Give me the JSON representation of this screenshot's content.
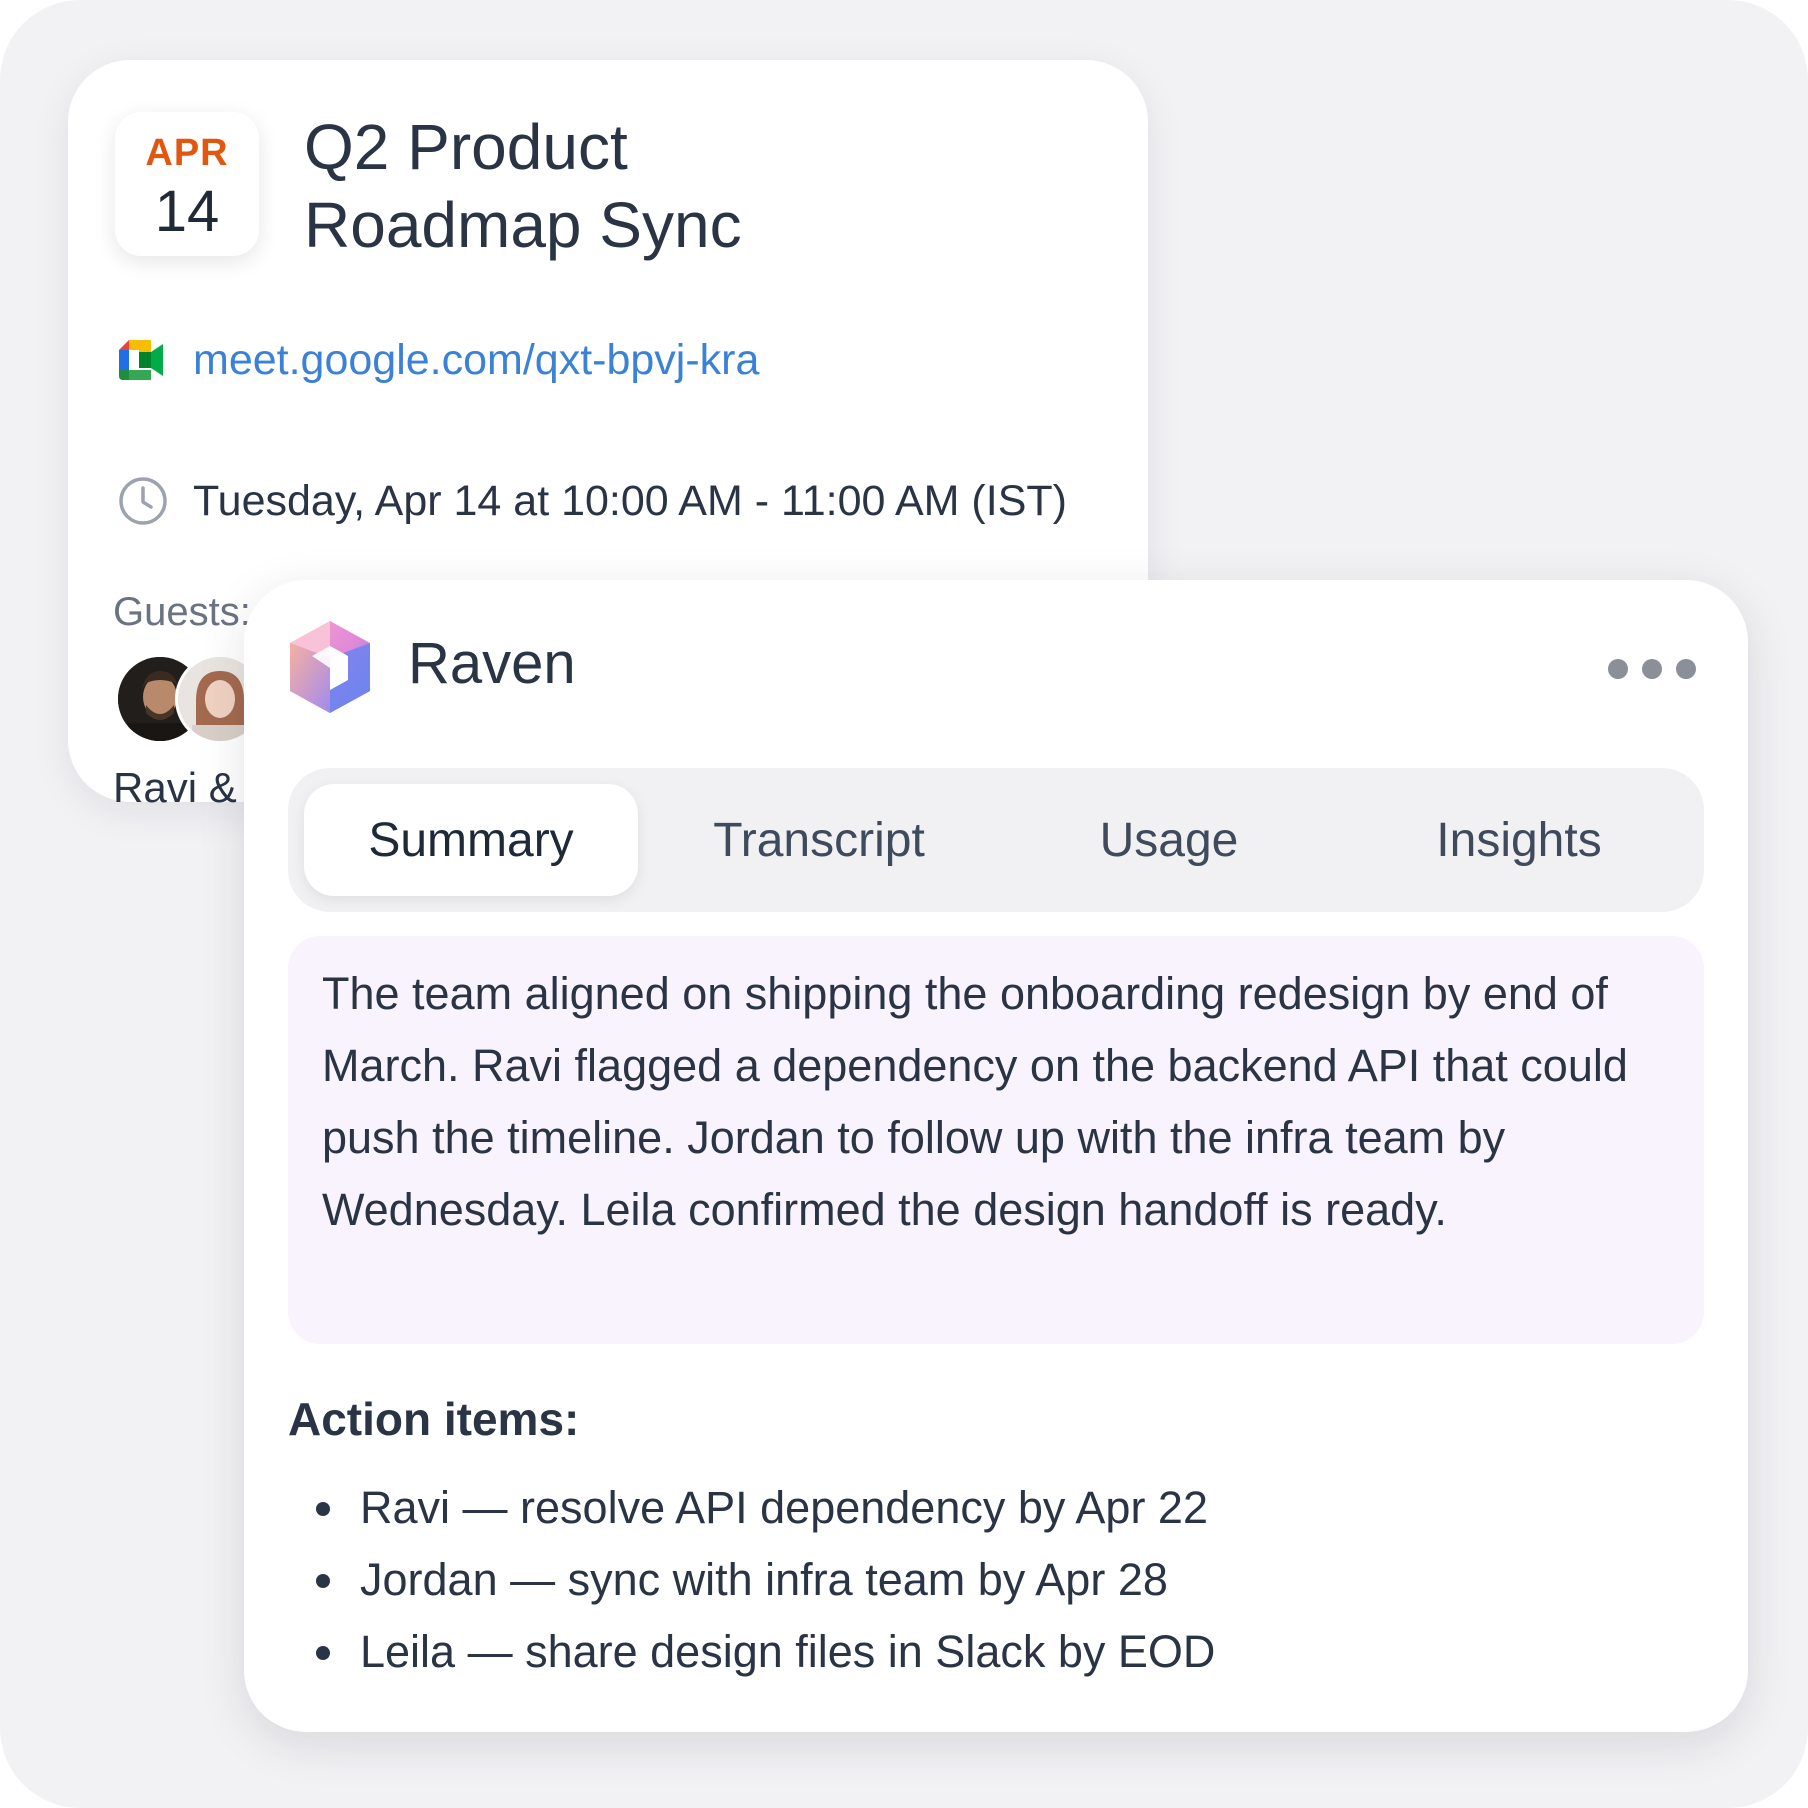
{
  "event": {
    "month": "APR",
    "day": "14",
    "title": "Q2 Product\nRoadmap Sync",
    "meet_link": "meet.google.com/qxt-bpvj-kra",
    "time": "Tuesday, Apr 14 at 10:00 AM - 11:00 AM (IST)",
    "guests_label": "Guests:",
    "guest_names": "Ravi &"
  },
  "raven": {
    "name": "Raven",
    "tabs": [
      {
        "label": "Summary",
        "active": true
      },
      {
        "label": "Transcript",
        "active": false
      },
      {
        "label": "Usage",
        "active": false
      },
      {
        "label": "Insights",
        "active": false
      }
    ],
    "summary": "The team aligned on shipping the onboarding redesign by end of March. Ravi flagged a dependency on the backend API that could push the timeline. Jordan to follow up with the infra team by Wednesday. Leila confirmed the design handoff is ready.",
    "action_items_title": "Action items:",
    "action_items": [
      "Ravi — resolve API dependency by Apr 22",
      "Jordan — sync with infra team by Apr 28",
      "Leila — share design files in Slack by EOD"
    ]
  },
  "colors": {
    "month_accent": "#e2570f",
    "link": "#3b82d6",
    "summary_bg": "#f8f3fd",
    "text_primary": "#2a3445"
  },
  "icons": [
    "google-meet-icon",
    "clock-icon",
    "raven-logo",
    "more-dots-icon"
  ]
}
